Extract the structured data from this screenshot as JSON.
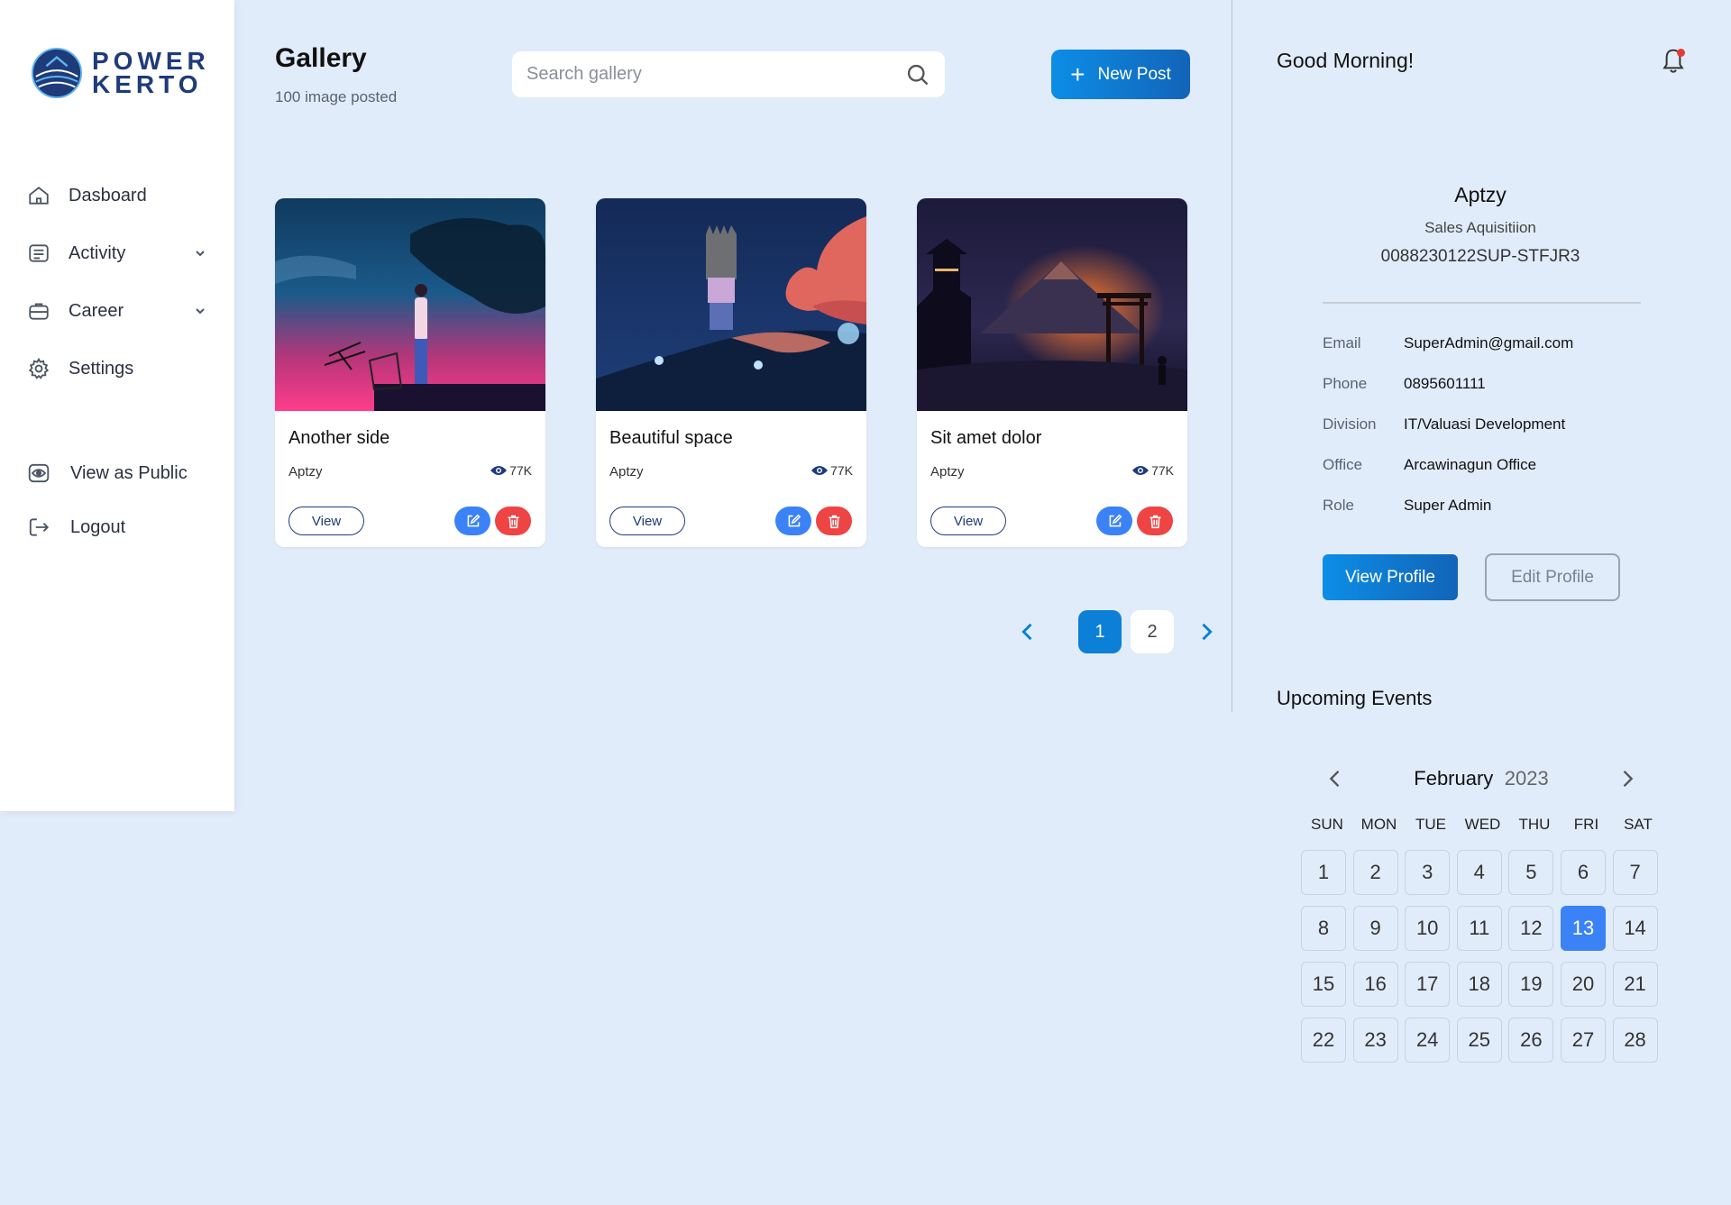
{
  "brand": {
    "line1": "POWER",
    "line2": "KERTO"
  },
  "sidebar": {
    "items": [
      {
        "label": "Dasboard",
        "icon": "home-icon"
      },
      {
        "label": "Activity",
        "icon": "activity-icon",
        "has_dropdown": true
      },
      {
        "label": "Career",
        "icon": "career-icon",
        "has_dropdown": true
      },
      {
        "label": "Settings",
        "icon": "gear-icon"
      }
    ],
    "secondary": [
      {
        "label": "View as Public",
        "icon": "eye-icon"
      },
      {
        "label": "Logout",
        "icon": "logout-icon"
      }
    ]
  },
  "main": {
    "title": "Gallery",
    "subtitle": "100 image posted",
    "search_placeholder": "Search gallery",
    "new_post_label": "New Post",
    "cards": [
      {
        "title": "Another side",
        "author": "Aptzy",
        "views": "77K",
        "view_label": "View"
      },
      {
        "title": "Beautiful space",
        "author": "Aptzy",
        "views": "77K",
        "view_label": "View"
      },
      {
        "title": "Sit amet dolor",
        "author": "Aptzy",
        "views": "77K",
        "view_label": "View"
      }
    ],
    "pagination": {
      "pages": [
        "1",
        "2"
      ],
      "current": "1"
    }
  },
  "right": {
    "greeting": "Good Morning!",
    "profile": {
      "name": "Aptzy",
      "role": "Sales Aquisitiion",
      "id": "0088230122SUP-STFJR3",
      "fields": [
        {
          "label": "Email",
          "value": "SuperAdmin@gmail.com"
        },
        {
          "label": "Phone",
          "value": "0895601111"
        },
        {
          "label": "Division",
          "value": "IT/Valuasi Development"
        },
        {
          "label": "Office",
          "value": "Arcawinagun Office"
        },
        {
          "label": "Role",
          "value": "Super Admin"
        }
      ],
      "view_profile_label": "View Profile",
      "edit_profile_label": "Edit Profile"
    },
    "events_title": "Upcoming Events",
    "calendar": {
      "month": "February",
      "year": "2023",
      "weekdays": [
        "SUN",
        "MON",
        "TUE",
        "WED",
        "THU",
        "FRI",
        "SAT"
      ],
      "days": [
        "1",
        "2",
        "3",
        "4",
        "5",
        "6",
        "7",
        "8",
        "9",
        "10",
        "11",
        "12",
        "13",
        "14",
        "15",
        "16",
        "17",
        "18",
        "19",
        "20",
        "21",
        "22",
        "23",
        "24",
        "25",
        "26",
        "27",
        "28"
      ],
      "selected": "13"
    }
  },
  "colors": {
    "background": "#e1ecfa",
    "accent": "#0c7fd6",
    "brand": "#1e3b7a",
    "danger": "#ef4444",
    "edit": "#3b82f6"
  }
}
